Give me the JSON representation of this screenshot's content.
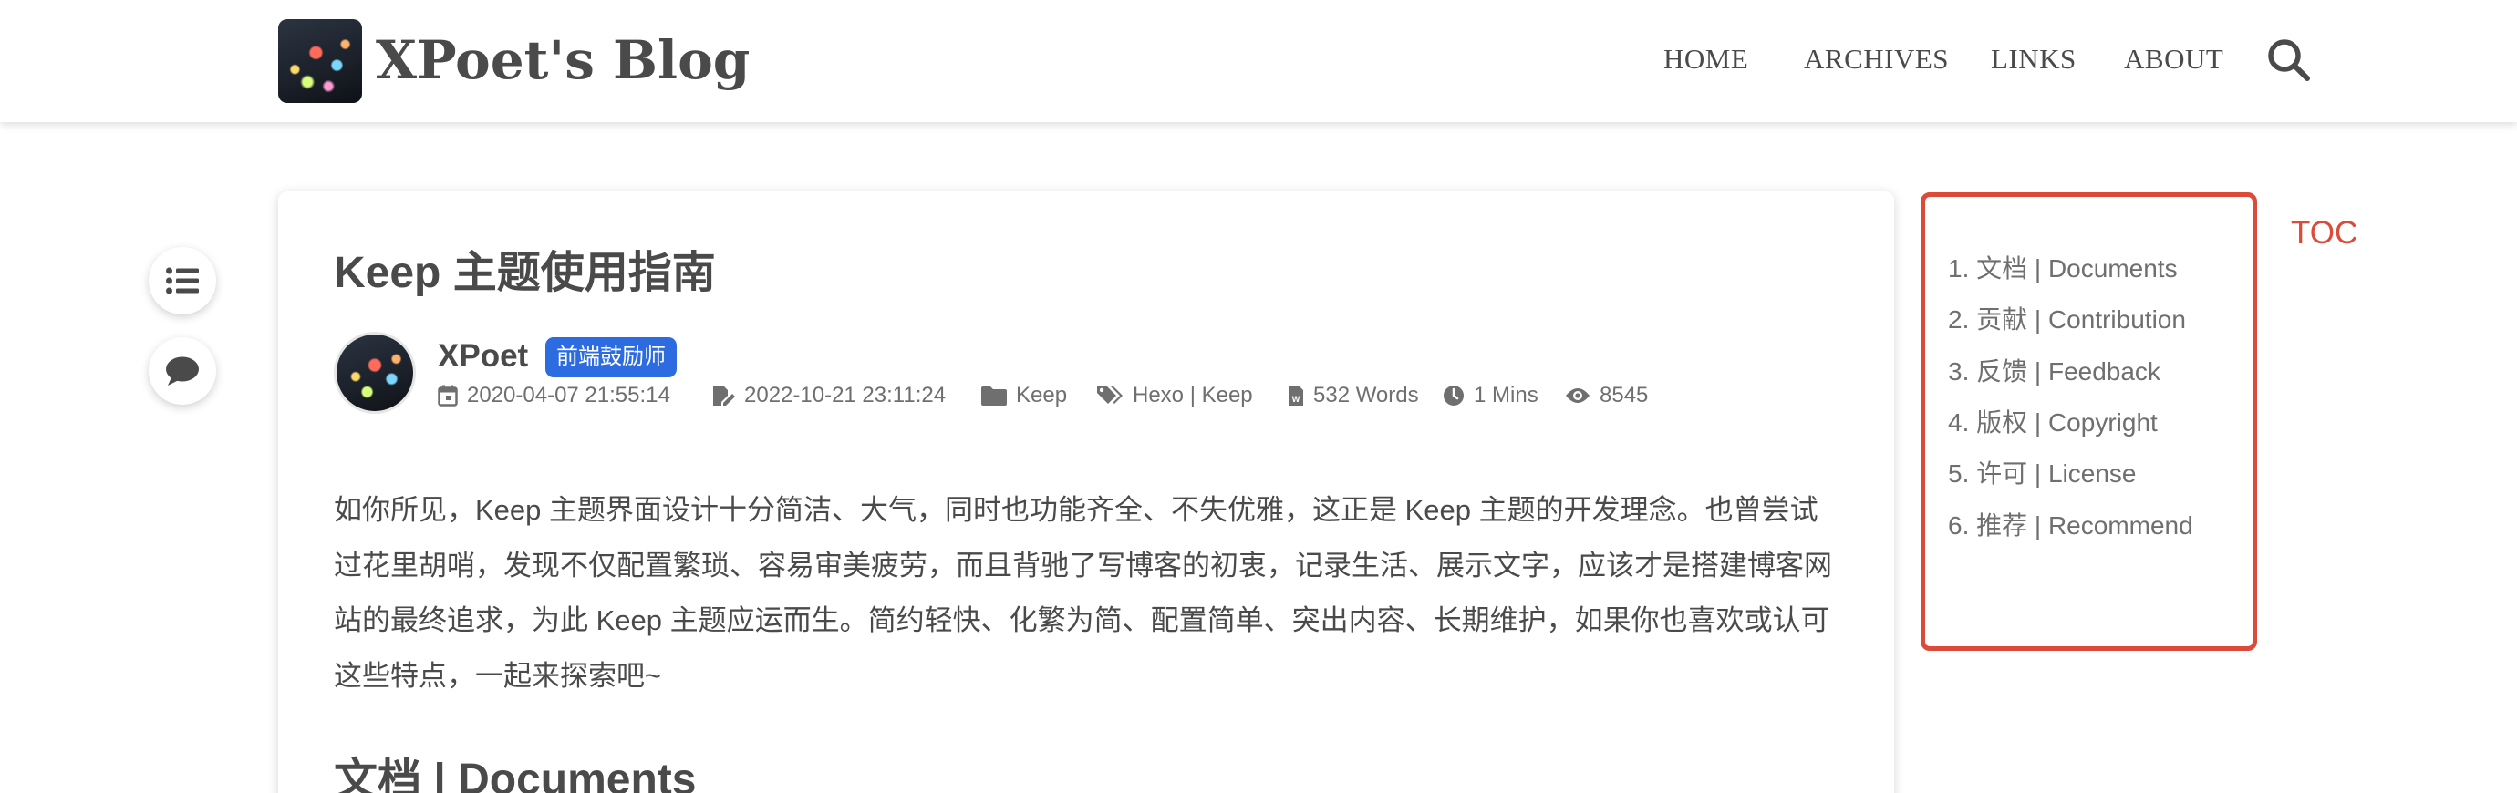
{
  "header": {
    "site_title": "XPoet's Blog",
    "nav": [
      "HOME",
      "ARCHIVES",
      "LINKS",
      "ABOUT"
    ]
  },
  "post": {
    "title": "Keep 主题使用指南",
    "author": "XPoet",
    "badge": "前端鼓励师",
    "created": "2020-04-07 21:55:14",
    "updated": "2022-10-21 23:11:24",
    "category": "Keep",
    "tags": "Hexo | Keep",
    "words": "532 Words",
    "read_time": "1 Mins",
    "views": "8545",
    "body": "如你所见，Keep 主题界面设计十分简洁、大气，同时也功能齐全、不失优雅，这正是 Keep 主题的开发理念。也曾尝试过花里胡哨，发现不仅配置繁琐、容易审美疲劳，而且背驰了写博客的初衷，记录生活、展示文字，应该才是搭建博客网站的最终追求，为此 Keep 主题应运而生。简约轻快、化繁为简、配置简单、突出内容、长期维护，如果你也喜欢或认可这些特点，一起来探索吧~",
    "section_heading": "文档 | Documents"
  },
  "toc": {
    "label": "TOC",
    "items": [
      "1. 文档 | Documents",
      "2. 贡献 | Contribution",
      "3. 反馈 | Feedback",
      "4. 版权 | Copyright",
      "5. 许可 | License",
      "6. 推荐 | Recommend"
    ]
  },
  "colors": {
    "accent_badge": "#2d6be0",
    "toc_highlight": "#dc4a3a",
    "text": "#4a4a4a",
    "meta_text": "#6f6f6f"
  },
  "icons": [
    "search-icon",
    "list-icon",
    "comment-icon",
    "calendar-icon",
    "edit-icon",
    "folder-icon",
    "tags-icon",
    "word-file-icon",
    "clock-icon",
    "eye-icon"
  ]
}
